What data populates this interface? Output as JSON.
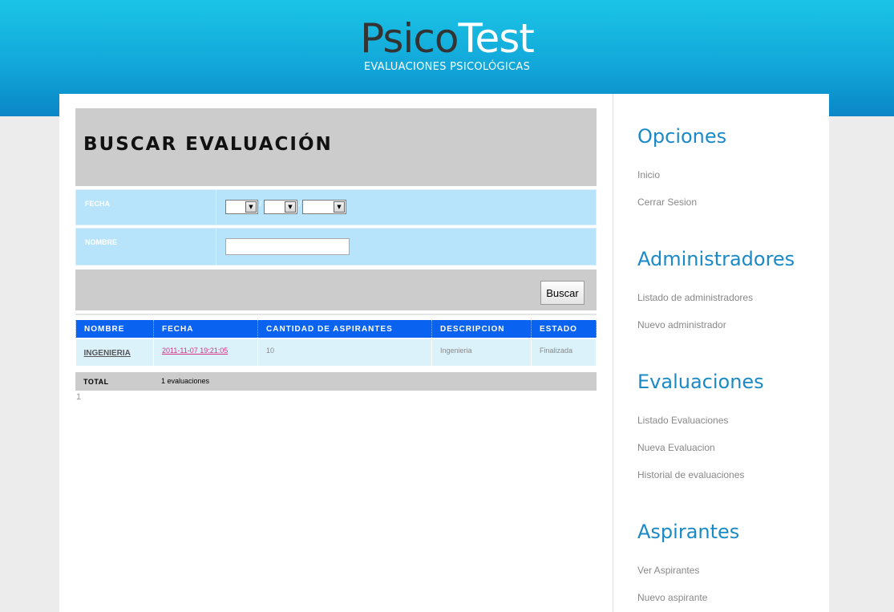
{
  "header": {
    "logo_part1": "Psico",
    "logo_part2": "Test",
    "subtitle": "EVALUACIONES PSICOLÓGICAS"
  },
  "page_title": "BUSCAR EVALUACIÓN",
  "form": {
    "fecha_label": "FECHA",
    "date_separator": "/",
    "day_value": "",
    "month_value": "",
    "year_value": "",
    "nombre_label": "NOMBRE",
    "nombre_value": "",
    "search_button": "Buscar"
  },
  "table": {
    "columns": [
      "NOMBRE",
      "FECHA",
      "CANTIDAD DE ASPIRANTES",
      "DESCRIPCION",
      "ESTADO"
    ],
    "rows": [
      {
        "nombre": "INGENIERIA",
        "fecha": "2011-11-07 19:21:05",
        "cantidad": "10",
        "descripcion": "Ingenieria",
        "estado": "Finalizada"
      }
    ],
    "total_label": "TOTAL",
    "total_value": "1 evaluaciones"
  },
  "pagination": {
    "page": "1"
  },
  "sidebar": {
    "sections": [
      {
        "heading": "Opciones",
        "links": [
          "Inicio",
          "Cerrar Sesion"
        ]
      },
      {
        "heading": "Administradores",
        "links": [
          "Listado de administradores",
          "Nuevo administrador"
        ]
      },
      {
        "heading": "Evaluaciones",
        "links": [
          "Listado Evaluaciones",
          "Nueva Evaluacion",
          "Historial de evaluaciones"
        ]
      },
      {
        "heading": "Aspirantes",
        "links": [
          "Ver Aspirantes",
          "Nuevo aspirante"
        ]
      }
    ]
  },
  "colors": {
    "header_top": "#1bc4e6",
    "header_bottom": "#0a86c6",
    "table_header": "#0a63f0",
    "form_row": "#b8e4fb",
    "sidebar_heading": "#1a8ac6",
    "date_link": "#d62f86"
  }
}
